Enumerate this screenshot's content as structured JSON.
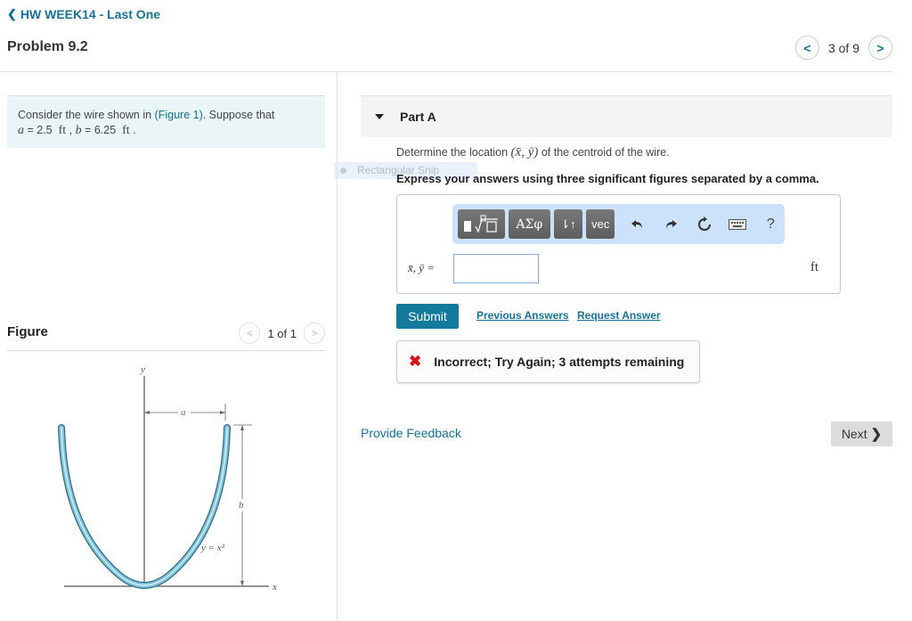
{
  "nav": {
    "back_icon": "chevron-left-icon",
    "back_label": "HW WEEK14 - Last One"
  },
  "problem": {
    "title": "Problem 9.2",
    "pager": {
      "prev_icon": "chevron-left-icon",
      "text": "3 of 9",
      "next_icon": "chevron-right-icon"
    },
    "statement_pre": "Consider the wire shown in ",
    "figure_link": "(Figure 1)",
    "statement_post": ". Suppose that",
    "a_var": "a",
    "a_value": "2.5",
    "b_var": "b",
    "b_value": "6.25",
    "unit": "ft"
  },
  "figure": {
    "title": "Figure",
    "pager": {
      "text": "1 of 1"
    },
    "labels": {
      "y_axis": "y",
      "x_axis": "x",
      "a": "a",
      "b": "b",
      "equation": "y = x²"
    }
  },
  "part": {
    "title": "Part A",
    "question_pre": "Determine the location ",
    "question_math": "(x̄, ȳ)",
    "question_post": " of the centroid of the wire.",
    "instruction": "Express your answers using three significant figures separated by a comma.",
    "toolbar": {
      "templates_icon": "templates-sqrt-icon",
      "greek_label": "ΑΣφ",
      "arrows_label": "⇂↑",
      "vec_label": "vec",
      "undo_icon": "undo-icon",
      "redo_icon": "redo-icon",
      "reset_icon": "reset-icon",
      "keyboard_icon": "keyboard-icon",
      "help_label": "?"
    },
    "answer_label": "x̄, ȳ =",
    "answer_value": "",
    "answer_unit": "ft",
    "submit_label": "Submit",
    "previous_answers_label": "Previous Answers",
    "request_answer_label": "Request Answer",
    "feedback": {
      "icon": "x-mark-icon",
      "text": "Incorrect; Try Again; 3 attempts remaining",
      "color": "#d9101a"
    }
  },
  "overlay": {
    "snip_label": "Rectangular Snip"
  },
  "footer": {
    "provide_feedback": "Provide Feedback",
    "next_label": "Next"
  },
  "colors": {
    "link": "#14729b",
    "submit_bg": "#137a9b",
    "problem_bg": "#e9f5f7",
    "toolbar_bg": "#cce2fa",
    "wire": "#5aa7c4"
  }
}
